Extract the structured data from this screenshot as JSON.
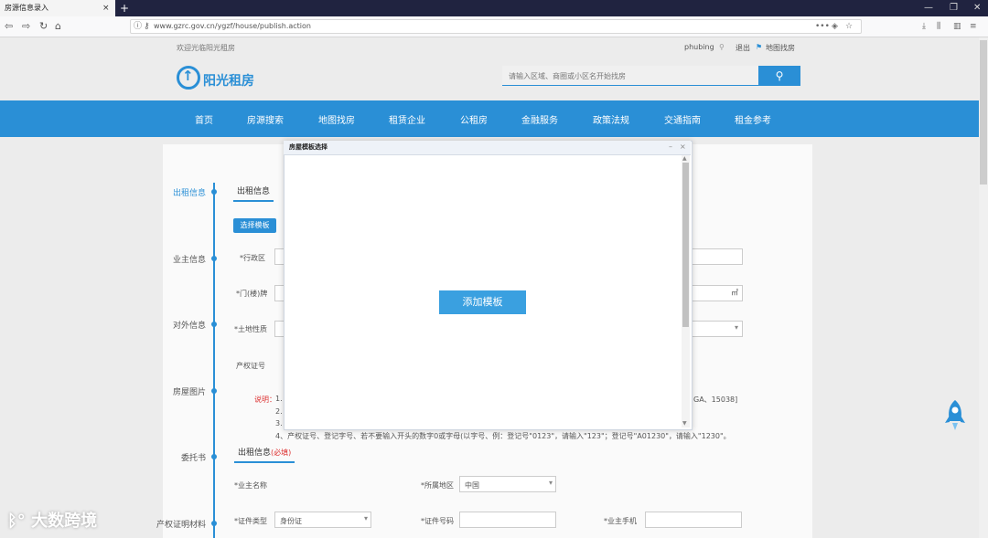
{
  "browser": {
    "tab_title": "房源信息录入",
    "tab_close": "×",
    "new_tab": "+",
    "url": "www.gzrc.gov.cn/ygzf/house/publish.action",
    "url_more": "•••",
    "win_min": "—",
    "win_max": "❐",
    "win_close": "✕"
  },
  "site": {
    "welcome": "欢迎光临阳光租房",
    "username": "phubing",
    "logout": "退出",
    "map_search": "地图找房",
    "logo_text": "阳光租房",
    "search_placeholder": "请输入区域、商圈或小区名开始找房",
    "nav": [
      "首页",
      "房源搜索",
      "地图找房",
      "租赁企业",
      "公租房",
      "金融服务",
      "政策法规",
      "交通指南",
      "租金参考"
    ]
  },
  "form": {
    "timeline": [
      "出租信息",
      "业主信息",
      "对外信息",
      "房屋图片",
      "委托书",
      "产权证明材料"
    ],
    "section_tab": "出租信息",
    "select_btn": "选择模板",
    "fields": {
      "district": "*行政区",
      "door_no": "*门(楼)牌",
      "land_type": "*土地性质",
      "property_no": "产权证号",
      "unit_sqm": "㎡"
    },
    "note_label": "说明：",
    "note_1": "1.",
    "note_2": "2.",
    "note_3": "3.",
    "note_4": "4、产权证号、登记字号、若不要输入开头的数字0或字母(以字号、例：登记号\"0123\"，请输入\"123\"；登记号\"A01230\"，请输入\"1230\"。",
    "note_right": "GA、15038]",
    "owner_tab": "出租信息",
    "owner_tab_suffix": "(必填)",
    "owner_name": "*业主名称",
    "owner_region": "*所属地区",
    "owner_region_value": "中国",
    "id_type": "*证件类型",
    "id_type_value": "身份证",
    "id_no": "*证件号码",
    "owner_phone": "*业主手机"
  },
  "modal": {
    "title": "房屋模板选择",
    "add_button": "添加模板",
    "min": "–",
    "close": "×"
  },
  "watermark": "大数跨境"
}
